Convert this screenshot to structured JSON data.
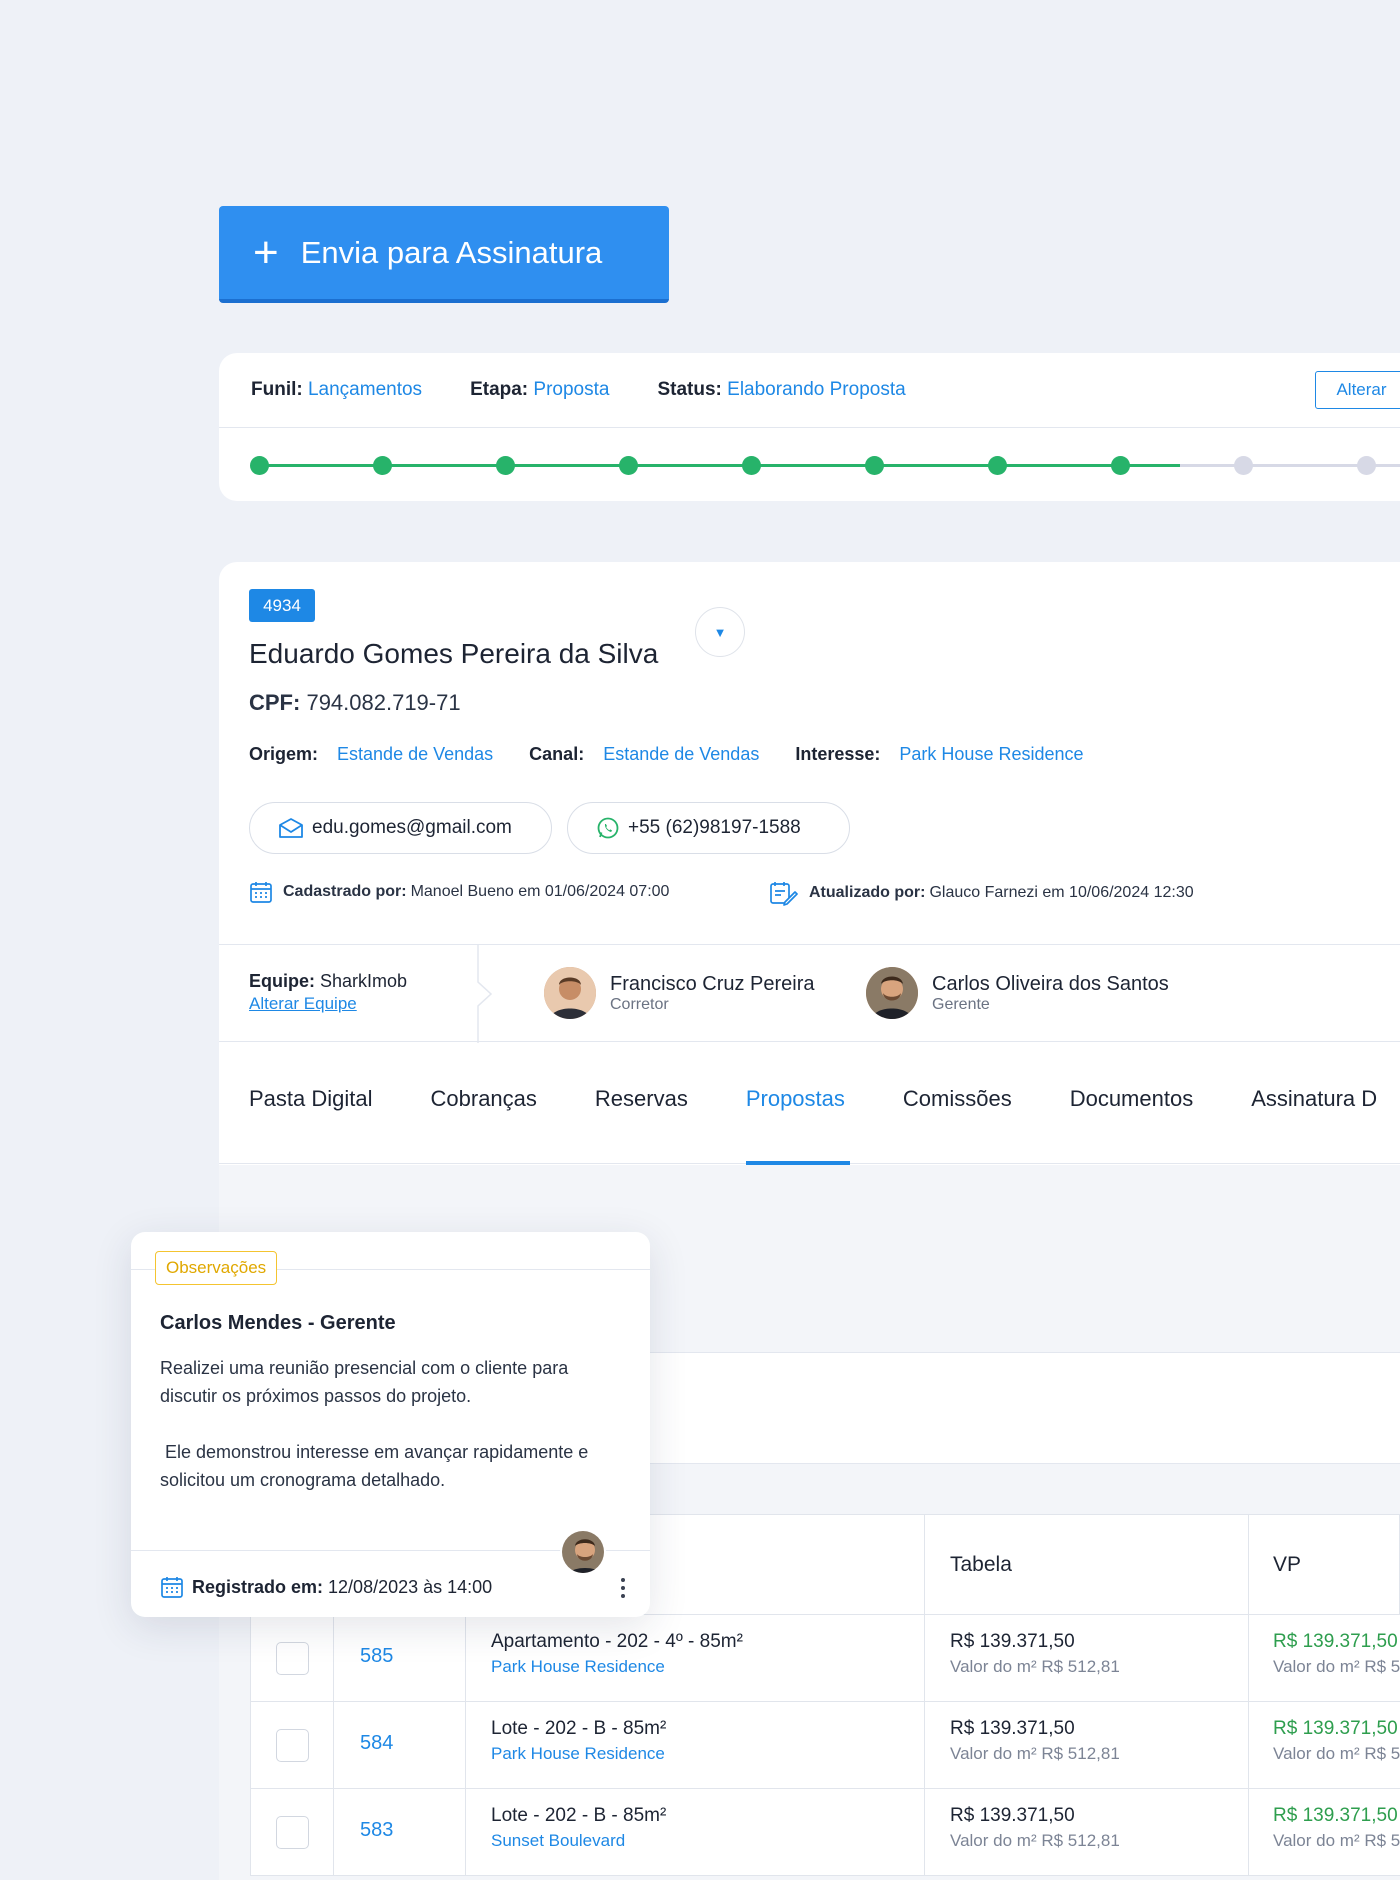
{
  "actions": {
    "send_signature": "Envia para Assinatura"
  },
  "funnel": {
    "funil_label": "Funil:",
    "funil_value": "Lançamentos",
    "etapa_label": "Etapa:",
    "etapa_value": "Proposta",
    "status_label": "Status:",
    "status_value": "Elaborando Proposta",
    "alter_button": "Alterar",
    "steps_total": 10,
    "steps_completed": 8
  },
  "client": {
    "id": "4934",
    "name": "Eduardo Gomes Pereira da Silva",
    "cpf_label": "CPF:",
    "cpf": "794.082.719-71",
    "origem_label": "Origem:",
    "origem": "Estande de Vendas",
    "canal_label": "Canal:",
    "canal": "Estande de Vendas",
    "interesse_label": "Interesse:",
    "interesse": "Park House Residence",
    "email": "edu.gomes@gmail.com",
    "phone": "+55 (62)98197-1588",
    "cadastrado_label": "Cadastrado por:",
    "cadastrado": "Manoel Bueno em 01/06/2024 07:00",
    "atualizado_label": "Atualizado por:",
    "atualizado": "Glauco Farnezi em 10/06/2024 12:30"
  },
  "team": {
    "label": "Equipe:",
    "name": "SharkImob",
    "alter_link": "Alterar Equipe",
    "members": [
      {
        "name": "Francisco Cruz Pereira",
        "role": "Corretor"
      },
      {
        "name": "Carlos Oliveira dos Santos",
        "role": "Gerente"
      }
    ]
  },
  "tabs": [
    "Pasta Digital",
    "Cobranças",
    "Reservas",
    "Propostas",
    "Comissões",
    "Documentos",
    "Assinatura D"
  ],
  "active_tab": "Propostas",
  "table": {
    "columns": [
      "Tabela",
      "VP"
    ],
    "rows": [
      {
        "id": "585",
        "desc": "Apartamento - 202 - 4º - 85m²",
        "project": "Park House Residence",
        "tabela": "R$ 139.371,50",
        "tabela_sub": "Valor do m² R$ 512,81",
        "vp": "R$ 139.371,50",
        "vp_sub": "Valor do m² R$ 5"
      },
      {
        "id": "584",
        "desc": "Lote - 202 - B - 85m²",
        "project": "Park House Residence",
        "tabela": "R$ 139.371,50",
        "tabela_sub": "Valor do m² R$ 512,81",
        "vp": "R$ 139.371,50",
        "vp_sub": "Valor do m² R$ 5"
      },
      {
        "id": "583",
        "desc": "Lote - 202 - B - 85m²",
        "project": "Sunset Boulevard",
        "tabela": "R$ 139.371,50",
        "tabela_sub": "Valor do m² R$ 512,81",
        "vp": "R$ 139.371,50",
        "vp_sub": "Valor do m² R$ 5"
      }
    ]
  },
  "observation": {
    "tag": "Observações",
    "author": "Carlos Mendes - Gerente",
    "paragraph1": "Realizei uma reunião presencial com o cliente para discutir os próximos passos do projeto.",
    "paragraph2": " Ele demonstrou interesse em avançar rapidamente e solicitou um cronograma detalhado.",
    "registered_label": "Registrado em:",
    "registered_at": "12/08/2023 às 14:00"
  },
  "colors": {
    "primary": "#1e88e5",
    "success": "#27b36a",
    "pending": "#d7d9e6",
    "warning": "#f4c430"
  }
}
